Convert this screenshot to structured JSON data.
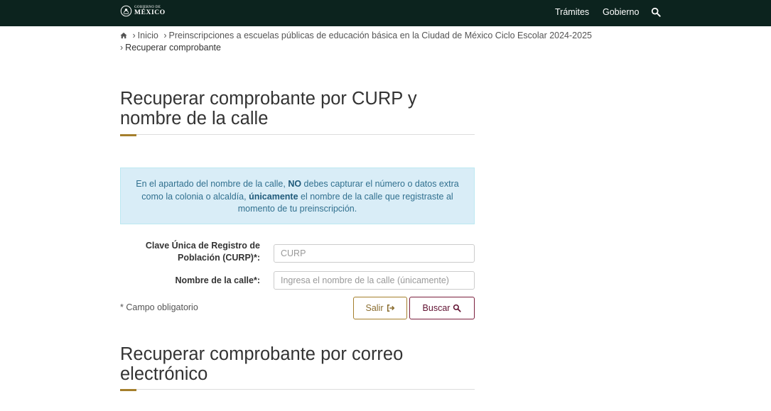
{
  "header": {
    "logo_top": "GOBIERNO DE",
    "logo_bottom": "MÉXICO",
    "nav": [
      {
        "label": "Trámites"
      },
      {
        "label": "Gobierno"
      }
    ],
    "search_icon": "search-icon",
    "background": "#0c231e"
  },
  "breadcrumb": {
    "home_icon": "home-icon",
    "items": [
      {
        "label": "Inicio"
      },
      {
        "label": "Preinscripciones a escuelas públicas de educación básica en la Ciudad de México Ciclo Escolar 2024-2025"
      }
    ],
    "current": "Recuperar comprobante"
  },
  "section1": {
    "title_line1": "Recuperar comprobante por CURP y",
    "title_line2": "nombre de la calle",
    "alert": {
      "part1": "En el apartado del nombre de la calle, ",
      "bold1": "NO",
      "part2": " debes capturar el número o datos extra como la colonia o alcaldía, ",
      "bold2": "únicamente",
      "part3": " el nombre de la calle que registraste al momento de tu preinscripción."
    },
    "curp_label_line1": "Clave Única de Registro de",
    "curp_label_line2": "Población (CURP)*:",
    "curp_placeholder": "CURP",
    "street_label": "Nombre de la calle*:",
    "street_placeholder": "Ingresa el nombre de la calle (únicamente)",
    "required_note": "* Campo obligatorio",
    "exit_label": "Salir",
    "exit_icon": "sign-out-icon",
    "search_label": "Buscar",
    "search_icon": "search-icon"
  },
  "section2": {
    "title_line1": "Recuperar comprobante por correo",
    "title_line2": "electrónico"
  },
  "colors": {
    "accent_gold": "#a57f2c",
    "accent_wine": "#611232",
    "alert_bg": "#d9edf7",
    "alert_text": "#31708f"
  }
}
